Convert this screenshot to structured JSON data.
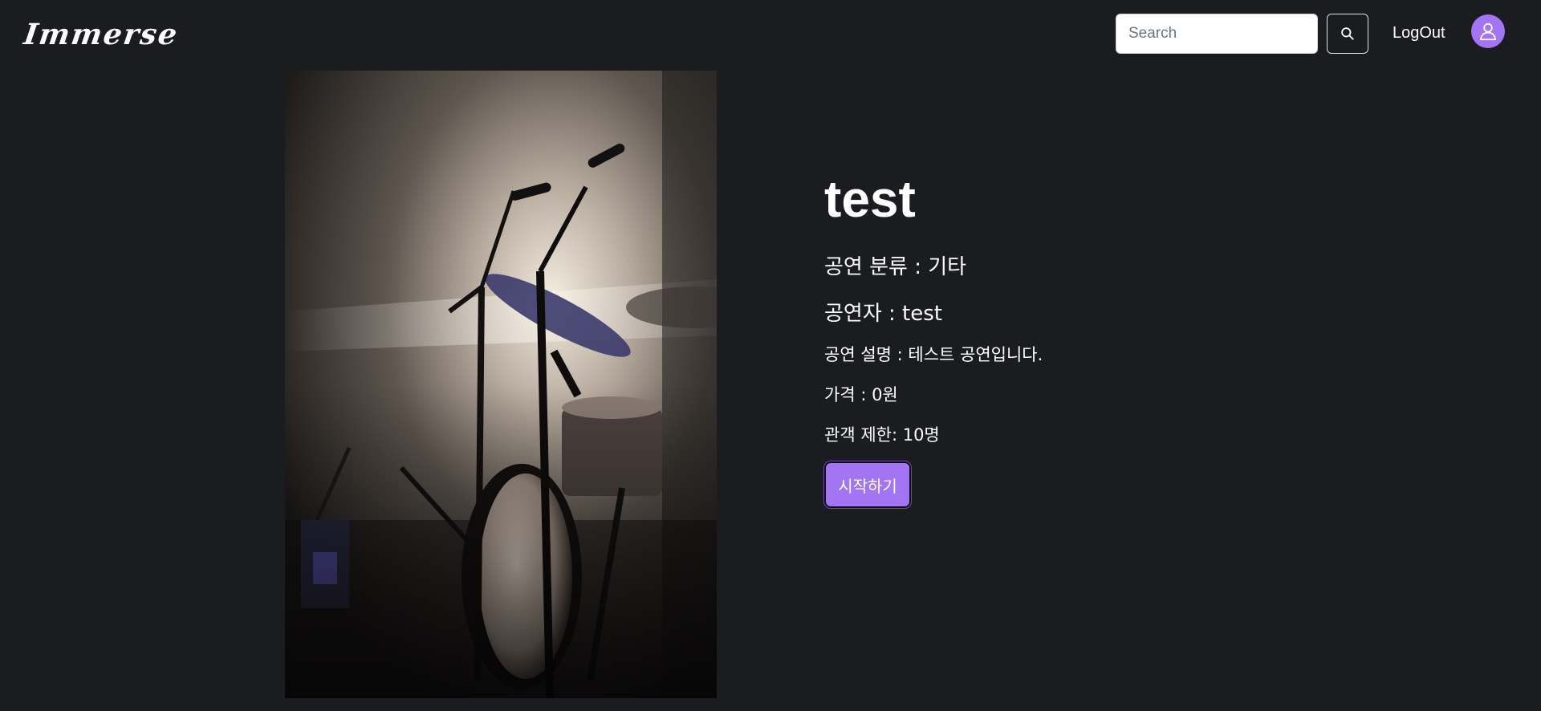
{
  "header": {
    "logo_text": "Immerse",
    "search_placeholder": "Search",
    "search_value": "",
    "logout_label": "LogOut"
  },
  "icons": {
    "search": "search-icon",
    "avatar": "user-icon"
  },
  "performance": {
    "title": "test",
    "genre": "공연 분류 : 기타",
    "performer": "공연자 : test",
    "description": "공연 설명 : 테스트 공연입니다.",
    "price": "가격 : 0원",
    "capacity": "관객 제한: 10명",
    "start_label": "시작하기"
  },
  "colors": {
    "background": "#1b1c20",
    "accent": "#a374f4"
  }
}
